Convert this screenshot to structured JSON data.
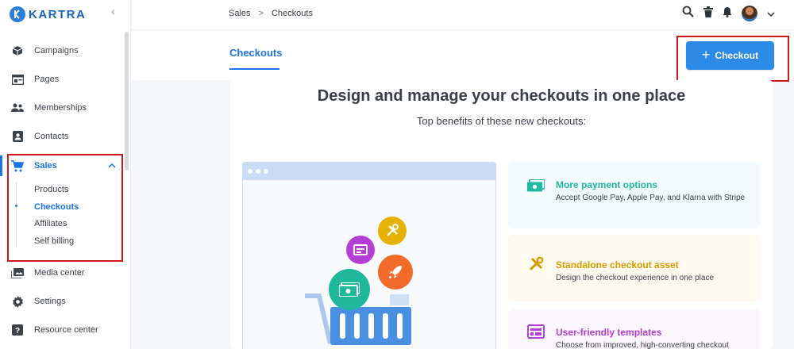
{
  "app": {
    "brand": "KARTRA"
  },
  "sidebar": {
    "items": [
      {
        "label": "Campaigns",
        "icon": "cube-icon"
      },
      {
        "label": "Pages",
        "icon": "browser-window-icon"
      },
      {
        "label": "Memberships",
        "icon": "people-icon"
      },
      {
        "label": "Contacts",
        "icon": "contact-card-icon"
      },
      {
        "label": "Sales",
        "icon": "cart-icon"
      },
      {
        "label": "Media center",
        "icon": "media-icon"
      },
      {
        "label": "Settings",
        "icon": "gear-icon"
      },
      {
        "label": "Resource center",
        "icon": "help-icon"
      }
    ],
    "sales_sub": [
      "Products",
      "Checkouts",
      "Affiliates",
      "Self billing"
    ]
  },
  "breadcrumb": {
    "parent": "Sales",
    "separator": ">",
    "current": "Checkouts"
  },
  "tabs": {
    "active": "Checkouts"
  },
  "actions": {
    "new_checkout": "Checkout"
  },
  "hero": {
    "title": "Design and manage your checkouts in one place",
    "subtitle": "Top benefits of these new checkouts:"
  },
  "features": [
    {
      "title": "More payment options",
      "desc": "Accept Google Pay, Apple Pay, and Klarna with Stripe",
      "color": "#1fb8a0",
      "bg": "#f4f9fd"
    },
    {
      "title": "Standalone checkout asset",
      "desc": "Design the checkout experience in one place",
      "color": "#d99a00",
      "bg": "#fffaf0"
    },
    {
      "title": "User-friendly templates",
      "desc": "Choose from improved, high-converting checkout",
      "color": "#b53fd6",
      "bg": "#fbf5fd"
    }
  ],
  "colors": {
    "accent": "#1a73e8",
    "button": "#2b8be6",
    "highlight_box": "#d0161d"
  }
}
